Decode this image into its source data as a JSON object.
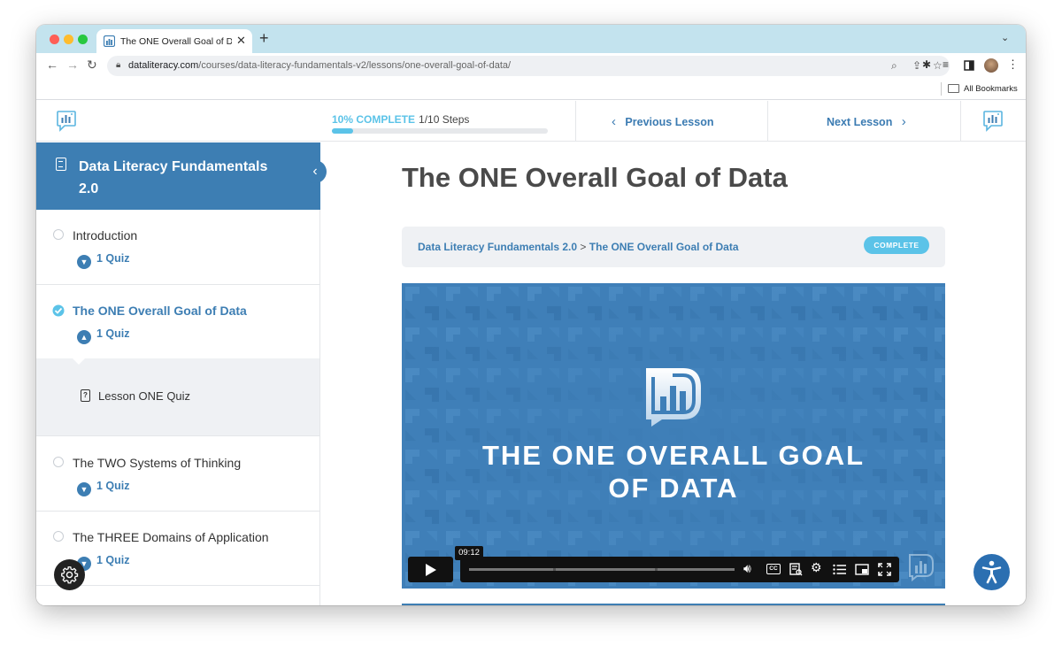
{
  "browser": {
    "tab_title": "The ONE Overall Goal of Data",
    "url_domain": "dataliteracy.com",
    "url_path": "/courses/data-literacy-fundamentals-v2/lessons/one-overall-goal-of-data/",
    "bookmarks_label": "All Bookmarks",
    "icons": [
      "back-icon",
      "forward-icon",
      "reload-icon",
      "lock-icon",
      "zoom-icon",
      "share-icon",
      "star-icon",
      "extensions-icon",
      "reading-list-icon",
      "sidepanel-icon",
      "profile-avatar",
      "kebab-menu-icon"
    ]
  },
  "header": {
    "progress_percent_label": "10% COMPLETE",
    "progress_steps": "1/10 Steps",
    "progress_fraction": 0.1,
    "prev_label": "Previous Lesson",
    "next_label": "Next Lesson"
  },
  "sidebar": {
    "course_title": "Data Literacy Fundamentals 2.0",
    "lessons": [
      {
        "title": "Introduction",
        "quiz": "1 Quiz",
        "state": "incomplete",
        "expanded": false
      },
      {
        "title": "The ONE Overall Goal of Data",
        "quiz": "1 Quiz",
        "state": "complete",
        "expanded": true
      },
      {
        "title": "The TWO Systems of Thinking",
        "quiz": "1 Quiz",
        "state": "incomplete",
        "expanded": false
      },
      {
        "title": "The THREE Domains of Application",
        "quiz": "1 Quiz",
        "state": "incomplete",
        "expanded": false
      }
    ],
    "quiz_item": "Lesson ONE Quiz"
  },
  "main": {
    "heading": "The ONE Overall Goal of Data",
    "breadcrumb_course": "Data Literacy Fundamentals 2.0",
    "breadcrumb_sep": ">",
    "breadcrumb_lesson": "The ONE Overall Goal of Data",
    "status_badge": "COMPLETE",
    "video": {
      "title_line1": "THE ONE OVERALL GOAL",
      "title_line2": "OF DATA",
      "time_tooltip": "09:12",
      "cc_label": "CC"
    }
  },
  "colors": {
    "brand_blue": "#3d7eb3",
    "accent_cyan": "#5bc3e8",
    "video_bg": "#3f7fb8"
  }
}
